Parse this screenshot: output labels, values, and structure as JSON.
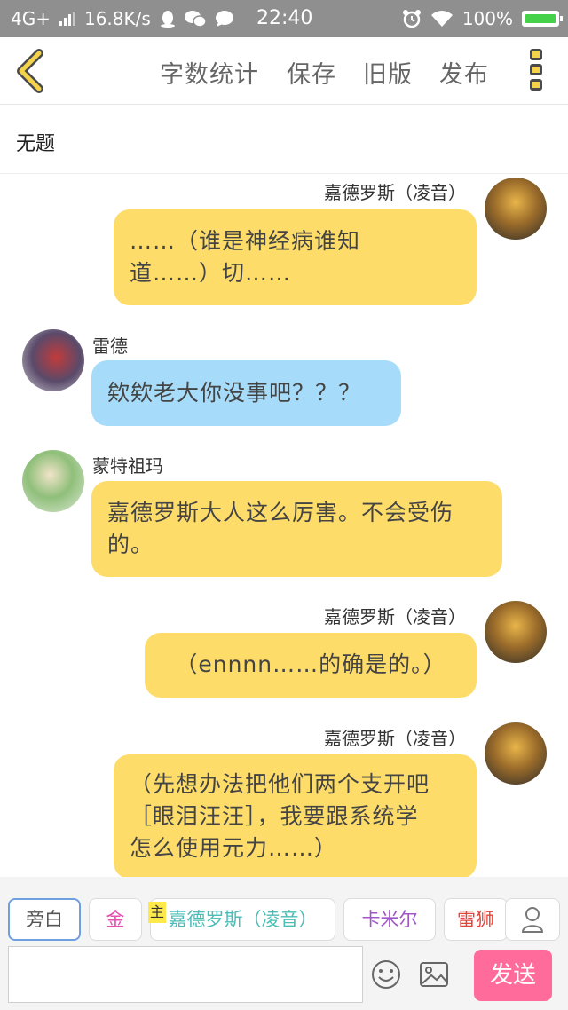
{
  "status_bar": {
    "network": "4G+",
    "speed": "16.8K/s",
    "time": "22:40",
    "battery": "100%"
  },
  "toolbar": {
    "word_count": "字数统计",
    "save": "保存",
    "old_version": "旧版",
    "publish": "发布"
  },
  "title": "无题",
  "messages": [
    {
      "side": "right",
      "name": "嘉德罗斯（凌音）",
      "color": "#fedc6a",
      "lines": [
        "……（谁是神经病谁知",
        "道……）切……"
      ]
    },
    {
      "side": "left",
      "name": "雷德",
      "color": "#a6dcf9",
      "lines": [
        "欸欸老大你没事吧？？？"
      ]
    },
    {
      "side": "left",
      "name": "蒙特祖玛",
      "color": "#fedc6a",
      "lines": [
        "嘉德罗斯大人这么厉害。不会受伤",
        "的。"
      ]
    },
    {
      "side": "right",
      "name": "嘉德罗斯（凌音）",
      "color": "#fedc6a",
      "lines": [
        "（ennnn……的确是的。）"
      ]
    },
    {
      "side": "right",
      "name": "嘉德罗斯（凌音）",
      "color": "#fedc6a",
      "lines": [
        "（先想办法把他们两个支开吧",
        "［眼泪汪汪］，我要跟系统学",
        "怎么使用元力……）"
      ]
    }
  ],
  "roles": {
    "narrator": "旁白",
    "gold": "金",
    "host_badge": "主",
    "jiade": "嘉德罗斯（凌音）",
    "kamir": "卡米尔",
    "leishi": "雷狮"
  },
  "input": {
    "value": "",
    "placeholder": ""
  },
  "send_label": "发送",
  "colors": {
    "yellow_bubble": "#fedc6a",
    "blue_bubble": "#a6dcf9",
    "send": "#ff6b9b",
    "gold_chip": "#e94fb2",
    "jiade_chip": "#4cbcb6",
    "kamir_chip": "#a056c8",
    "leishi_chip": "#e0463c"
  }
}
